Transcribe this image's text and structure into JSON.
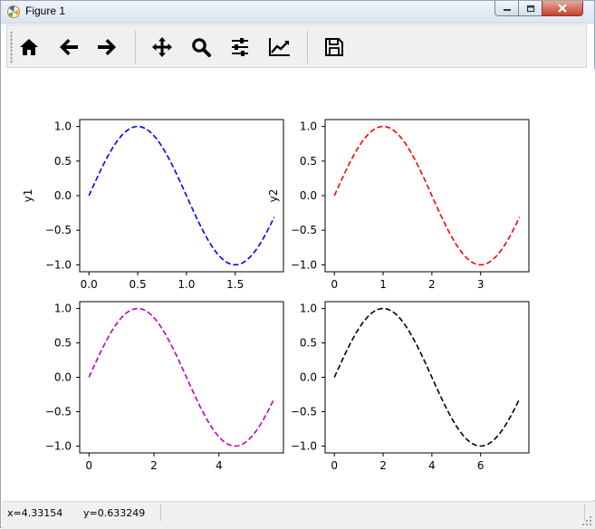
{
  "window": {
    "title": "Figure 1"
  },
  "toolbar": {
    "buttons": [
      {
        "name": "home-button",
        "icon": "home-icon"
      },
      {
        "name": "back-button",
        "icon": "arrow-left-icon"
      },
      {
        "name": "forward-button",
        "icon": "arrow-right-icon"
      },
      {
        "name": "pan-button",
        "icon": "move-icon"
      },
      {
        "name": "zoom-button",
        "icon": "zoom-icon"
      },
      {
        "name": "subplots-button",
        "icon": "sliders-icon"
      },
      {
        "name": "edit-axes-button",
        "icon": "line-chart-icon"
      },
      {
        "name": "save-button",
        "icon": "floppy-disk-icon"
      }
    ]
  },
  "status": {
    "x_text": "x=4.33154",
    "y_text": "y=0.633249"
  },
  "chart_data": [
    {
      "type": "line",
      "function": "sin(pi*x)",
      "x_range": [
        0,
        1.9
      ],
      "ylabel": "y1",
      "color": "#0000ff",
      "linestyle": "dashed",
      "xlim": [
        -0.095,
        1.995
      ],
      "ylim": [
        -1.1,
        1.1
      ],
      "xticks": [
        0.0,
        0.5,
        1.0,
        1.5
      ],
      "xtick_labels": [
        "0.0",
        "0.5",
        "1.0",
        "1.5"
      ],
      "yticks": [
        1.0,
        0.5,
        0.0,
        -0.5,
        -1.0
      ],
      "ytick_labels": [
        "1.0",
        "0.5",
        "0.0",
        "−0.5",
        "−1.0"
      ]
    },
    {
      "type": "line",
      "function": "sin(pi*x/2)",
      "x_range": [
        0,
        3.8
      ],
      "ylabel": "y2",
      "color": "#ff0000",
      "linestyle": "dashed",
      "xlim": [
        -0.19,
        3.99
      ],
      "ylim": [
        -1.1,
        1.1
      ],
      "xticks": [
        0,
        1,
        2,
        3
      ],
      "xtick_labels": [
        "0",
        "1",
        "2",
        "3"
      ],
      "yticks": [
        1.0,
        0.5,
        0.0,
        -0.5,
        -1.0
      ],
      "ytick_labels": [
        "1.0",
        "0.5",
        "0.0",
        "−0.5",
        "−1.0"
      ]
    },
    {
      "type": "line",
      "function": "sin(pi*x/3)",
      "x_range": [
        0,
        5.7
      ],
      "ylabel": "",
      "color": "#bf00bf",
      "linestyle": "dashed",
      "xlim": [
        -0.285,
        5.985
      ],
      "ylim": [
        -1.1,
        1.1
      ],
      "xticks": [
        0,
        2,
        4
      ],
      "xtick_labels": [
        "0",
        "2",
        "4"
      ],
      "yticks": [
        1.0,
        0.5,
        0.0,
        -0.5,
        -1.0
      ],
      "ytick_labels": [
        "1.0",
        "0.5",
        "0.0",
        "−0.5",
        "−1.0"
      ]
    },
    {
      "type": "line",
      "function": "sin(pi*x/4)",
      "x_range": [
        0,
        7.6
      ],
      "ylabel": "",
      "color": "#000000",
      "linestyle": "dashed",
      "xlim": [
        -0.38,
        7.98
      ],
      "ylim": [
        -1.1,
        1.1
      ],
      "xticks": [
        0,
        2,
        4,
        6
      ],
      "xtick_labels": [
        "0",
        "2",
        "4",
        "6"
      ],
      "yticks": [
        1.0,
        0.5,
        0.0,
        -0.5,
        -1.0
      ],
      "ytick_labels": [
        "1.0",
        "0.5",
        "0.0",
        "−0.5",
        "−1.0"
      ]
    }
  ]
}
